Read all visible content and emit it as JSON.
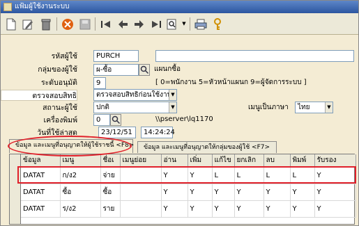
{
  "window": {
    "title": "แฟ้มผู้ใช้งานระบบ"
  },
  "toolbar": {
    "icons": [
      "new-icon",
      "edit-icon",
      "delete-icon",
      "cancel-icon",
      "save-icon",
      "first-icon",
      "prev-icon",
      "next-icon",
      "last-icon",
      "search-icon",
      "print-icon",
      "key-icon"
    ]
  },
  "form": {
    "user_code_label": "รหัสผู้ใช้",
    "user_code": "PURCH",
    "user_name": "",
    "group_label": "กลุ่มของผู้ใช้",
    "group_code": "ผ-ซื้อ",
    "group_name": "แผนกซื้อ",
    "level_label": "ระดับอนุมัติ",
    "level_value": "9",
    "level_hint": "[ 0=พนักงาน  5=หัวหน้าแผนก  9=ผู้จัดการระบบ ]",
    "check_label": "ตรวจสอบสิทธิ",
    "check_value": "ตรวจสอบสิทธิก่อนใช้งาน",
    "status_label": "สถานะผู้ใช้",
    "status_value": "ปกติ",
    "menu_lang_label": "เมนูเป็นภาษา",
    "menu_lang_value": "ไทย",
    "printer_label": "เครื่องพิมพ์",
    "printer_value": "0",
    "printer_path": "\\\\pserver\\lq1170",
    "lastused_label": "วันที่ใช้ล่าสุด",
    "lastused_date": "23/12/51",
    "lastused_time": "14:24:24"
  },
  "tabs": [
    {
      "label": "ข้อมูล และเมนูที่อนุญาตให้ผู้ใช้ราชนี้  <F8>",
      "active": true
    },
    {
      "label": "ข้อมูล และเมนูที่อนุญาตให้กลุ่มของผู้ใช้  <F7>",
      "active": false
    }
  ],
  "grid": {
    "columns": [
      "ข้อมูล",
      "เมนู",
      "ชื่อเ",
      "เมนูย่อย",
      "อ่าน",
      "เพิ่ม",
      "แก้ไข",
      "ยกเลิก",
      "ลบ",
      "พิมพ์",
      "รับรอง"
    ],
    "rows": [
      [
        "DATAT",
        "ก/ง2",
        "จ่าย",
        "",
        "Y",
        "Y",
        "L",
        "L",
        "L",
        "L",
        "Y"
      ],
      [
        "DATAT",
        "ซื้อ",
        "ซื้อ",
        "",
        "Y",
        "Y",
        "Y",
        "Y",
        "Y",
        "Y",
        "Y"
      ],
      [
        "DATAT",
        "ร/ง2",
        "ราย",
        "",
        "Y",
        "Y",
        "Y",
        "Y",
        "Y",
        "Y",
        "Y"
      ]
    ]
  },
  "colors": {
    "annotation": "#e0202a",
    "form_bg": "#f4ecd4",
    "title_bg": "#2c56a0"
  }
}
